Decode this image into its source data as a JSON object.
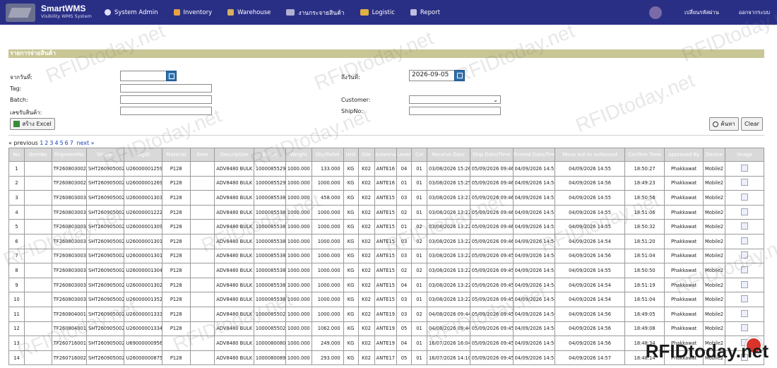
{
  "app": {
    "title": "SmartWMS",
    "subtitle": "Visibility WMS System"
  },
  "menu": [
    {
      "label": "System Admin",
      "icon": "gear-icon",
      "color": "#e0e0ff"
    },
    {
      "label": "Inventory",
      "icon": "box-icon",
      "color": "#e8a040"
    },
    {
      "label": "Warehouse",
      "icon": "warehouse-icon",
      "color": "#d4b060"
    },
    {
      "label": "งานกระจายสินค้า",
      "icon": "truck-icon",
      "color": "#b0b0d0"
    },
    {
      "label": "Logistic",
      "icon": "logistic-truck-icon",
      "color": "#e0b040"
    },
    {
      "label": "Report",
      "icon": "report-icon",
      "color": "#c0c0e0"
    }
  ],
  "nav_right": {
    "change_password": "เปลี่ยนรหัสผ่าน",
    "logout": "ออกจากระบบ"
  },
  "page": {
    "title": "รายการจ่ายสินค้า"
  },
  "form": {
    "from_date_label": "จากวันที่:",
    "from_date_value": "",
    "to_date_label": "ถึงวันที่:",
    "to_date_value": "2026-09-05",
    "tag_label": "Tag:",
    "batch_label": "Batch:",
    "receipt_label": "เลขรับสินค้า:",
    "customer_label": "Customer:",
    "customer_value": "",
    "shipno_label": "ShipNo:",
    "excel_button": "สร้าง Excel",
    "search_button": "ค้นหา",
    "clear_button": "Clear"
  },
  "pager": {
    "previous": "« previous",
    "pages": [
      "1",
      "2",
      "3",
      "4",
      "5",
      "6",
      "7"
    ],
    "next": "next »"
  },
  "table": {
    "headers": [
      "No",
      "ItemNo",
      "ShipmentNo",
      "ShipNo",
      "TagID",
      "Material",
      "Item",
      "Description",
      "Batch",
      "Weight",
      "Qty/Pallet",
      "Unit",
      "Site",
      "Antenna",
      "Level",
      "Col",
      "Receive Date",
      "Ship Date/Time",
      "Printed Date/Time",
      "Move out to outbound",
      "Confirm Time",
      "Approved By",
      "Device",
      "Image"
    ],
    "rows": [
      [
        "1",
        "",
        "TF260803002",
        "SHT260905002",
        "U26000001259",
        "P128",
        "",
        "ADV8480 BULK",
        "1000085529",
        "1000.000",
        "133.000",
        "KG",
        "K02",
        "ANTE16",
        "04",
        "01",
        "03/08/2026 15:26",
        "05/09/2026 09:46",
        "04/09/2026 14:55",
        "04/09/2026 14:55",
        "18:50:27",
        "Phakkawat",
        "Mobile2",
        ""
      ],
      [
        "2",
        "",
        "TF260803002",
        "SHT260905002",
        "U26000001269",
        "P128",
        "",
        "ADV8480 BULK",
        "1000085529",
        "1000.000",
        "1000.000",
        "KG",
        "K02",
        "ANTE16",
        "01",
        "01",
        "03/08/2026 15:25",
        "05/09/2026 09:46",
        "04/09/2026 14:56",
        "04/09/2026 14:56",
        "18:49:23",
        "Phakkawat",
        "Mobile2",
        ""
      ],
      [
        "3",
        "",
        "TF260803003",
        "SHT260905002",
        "U26000001303",
        "P128",
        "",
        "ADV8480 BULK",
        "1000085538",
        "1000.000",
        "458.000",
        "KG",
        "K02",
        "ANTE15",
        "03",
        "01",
        "03/08/2026 13:23",
        "05/09/2026 09:46",
        "04/09/2026 14:55",
        "04/09/2026 14:55",
        "18:50:56",
        "Phakkawat",
        "Mobile2",
        ""
      ],
      [
        "4",
        "",
        "TF260803003",
        "SHT260905002",
        "U26000001222",
        "P128",
        "",
        "ADV8480 BULK",
        "1000085538",
        "1000.000",
        "1000.000",
        "KG",
        "K02",
        "ANTE15",
        "02",
        "01",
        "03/08/2026 13:22",
        "05/09/2026 09:46",
        "04/09/2026 14:55",
        "04/09/2026 14:55",
        "18:51:06",
        "Phakkawat",
        "Mobile2",
        ""
      ],
      [
        "5",
        "",
        "TF260803003",
        "SHT260905002",
        "U26000001309",
        "P128",
        "",
        "ADV8480 BULK",
        "1000085538",
        "1000.000",
        "1000.000",
        "KG",
        "K02",
        "ANTE15",
        "01",
        "02",
        "03/08/2026 13:22",
        "05/09/2026 09:46",
        "04/09/2026 14:55",
        "04/09/2026 14:55",
        "18:50:32",
        "Phakkawat",
        "Mobile2",
        ""
      ],
      [
        "6",
        "",
        "TF260803003",
        "SHT260905002",
        "U26000001301",
        "P128",
        "",
        "ADV8480 BULK",
        "1000085538",
        "1000.000",
        "1000.000",
        "KG",
        "K02",
        "ANTE15",
        "03",
        "02",
        "03/08/2026 13:22",
        "05/09/2026 09:46",
        "04/09/2026 14:54",
        "04/09/2026 14:54",
        "18:51:20",
        "Phakkawat",
        "Mobile2",
        ""
      ],
      [
        "7",
        "",
        "TF260803003",
        "SHT260905002",
        "U26000001301",
        "P128",
        "",
        "ADV8480 BULK",
        "1000085538",
        "1000.000",
        "1000.000",
        "KG",
        "K02",
        "ANTE15",
        "03",
        "01",
        "03/08/2026 13:22",
        "05/09/2026 09:45",
        "04/09/2026 14:56",
        "04/09/2026 14:56",
        "18:51:04",
        "Phakkawat",
        "Mobile2",
        ""
      ],
      [
        "8",
        "",
        "TF260803003",
        "SHT260905002",
        "U26000001304",
        "P128",
        "",
        "ADV8480 BULK",
        "1000085538",
        "1000.000",
        "1000.000",
        "KG",
        "K02",
        "ANTE15",
        "02",
        "02",
        "03/08/2026 13:22",
        "05/09/2026 09:45",
        "04/09/2026 14:55",
        "04/09/2026 14:55",
        "18:50:50",
        "Phakkawat",
        "Mobile2",
        ""
      ],
      [
        "9",
        "",
        "TF260803003",
        "SHT260905002",
        "U26000001302",
        "P128",
        "",
        "ADV8480 BULK",
        "1000085538",
        "1000.000",
        "1000.000",
        "KG",
        "K02",
        "ANTE15",
        "04",
        "01",
        "03/08/2026 13:22",
        "05/09/2026 09:45",
        "04/09/2026 14:54",
        "04/09/2026 14:54",
        "18:51:19",
        "Phakkawat",
        "Mobile2",
        ""
      ],
      [
        "10",
        "",
        "TF260803003",
        "SHT260905002",
        "U26000001352",
        "P128",
        "",
        "ADV8480 BULK",
        "1000085538",
        "1000.000",
        "1000.000",
        "KG",
        "K02",
        "ANTE15",
        "03",
        "01",
        "03/08/2026 13:22",
        "05/09/2026 09:45",
        "04/09/2026 14:54",
        "04/09/2026 14:54",
        "18:51:04",
        "Phakkawat",
        "Mobile2",
        ""
      ],
      [
        "11",
        "",
        "TF260804001",
        "SHT260905002",
        "U26000001333",
        "P128",
        "",
        "ADV8480 BULK",
        "1000085502",
        "1000.000",
        "1000.000",
        "KG",
        "K02",
        "ANTE19",
        "03",
        "02",
        "04/08/2026 09:44",
        "05/09/2026 09:45",
        "04/09/2026 14:56",
        "04/09/2026 14:56",
        "18:49:05",
        "Phakkawat",
        "Mobile2",
        ""
      ],
      [
        "12",
        "",
        "TF260804001",
        "SHT260905002",
        "U26000001334",
        "P128",
        "",
        "ADV8480 BULK",
        "1000085502",
        "1000.000",
        "1062.000",
        "KG",
        "K02",
        "ANTE19",
        "05",
        "01",
        "04/08/2026 09:44",
        "05/09/2026 09:45",
        "04/09/2026 14:56",
        "04/09/2026 14:56",
        "18:49:08",
        "Phakkawat",
        "Mobile2",
        ""
      ],
      [
        "13",
        "",
        "TF260716001",
        "SHT260905002",
        "U69000000956",
        "",
        "",
        "ADV8480 BULK",
        "1000080080",
        "1000.000",
        "249.000",
        "KG",
        "K02",
        "ANTE19",
        "04",
        "01",
        "16/07/2026 16:04",
        "05/09/2026 09:45",
        "04/09/2026 14:56",
        "04/09/2026 14:56",
        "18:48:34",
        "Phakkawat",
        "Mobile2",
        ""
      ],
      [
        "14",
        "",
        "TF260716002",
        "SHT260905002",
        "U26000000875",
        "P128",
        "",
        "ADV8480 BULK",
        "1000080089",
        "1000.000",
        "293.000",
        "KG",
        "K02",
        "ANTE17",
        "05",
        "01",
        "16/07/2026 14:10",
        "05/09/2026 09:45",
        "04/09/2026 14:57",
        "04/09/2026 14:57",
        "18:48:14",
        "Phakkawat",
        "Mobile2",
        ""
      ]
    ]
  },
  "watermark": {
    "text": "RFIDtoday.net"
  }
}
